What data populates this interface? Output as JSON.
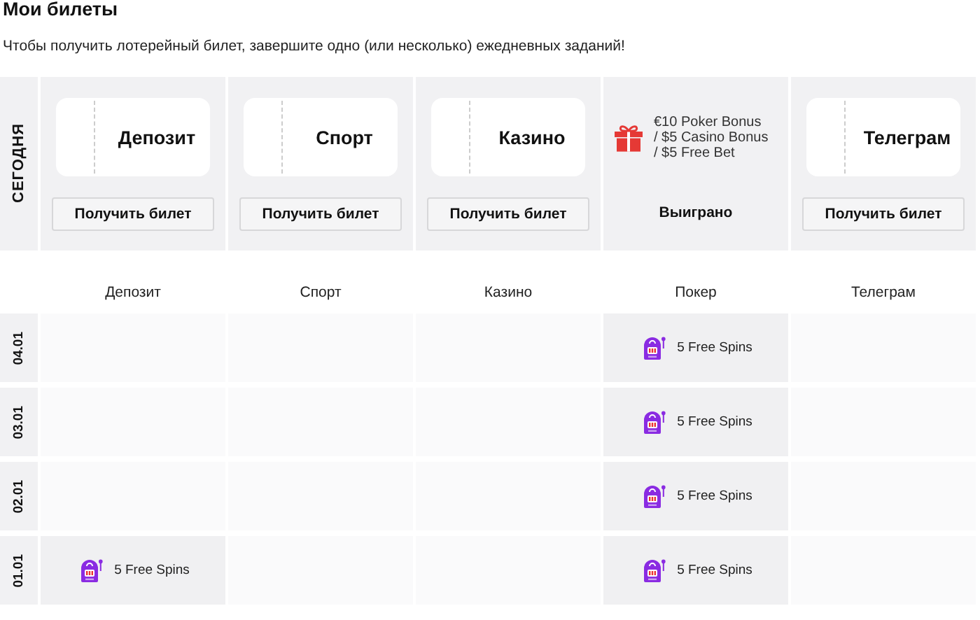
{
  "title": "Мои билеты",
  "subtitle": "Чтобы получить лотерейный билет, завершите одно (или несколько) ежедневных заданий!",
  "today": {
    "label": "СЕГОДНЯ",
    "tasks": [
      {
        "kind": "ticket",
        "label": "Депозит",
        "button": "Получить билет"
      },
      {
        "kind": "ticket",
        "label": "Спорт",
        "button": "Получить билет"
      },
      {
        "kind": "ticket",
        "label": "Казино",
        "button": "Получить билет"
      },
      {
        "kind": "won",
        "prize_lines": [
          "€10 Poker Bonus",
          "/ $5 Casino Bonus",
          "/ $5 Free Bet"
        ],
        "status": "Выиграно"
      },
      {
        "kind": "ticket",
        "label": "Телеграм",
        "button": "Получить билет"
      }
    ]
  },
  "history": {
    "columns": [
      "Депозит",
      "Спорт",
      "Казино",
      "Покер",
      "Телеграм"
    ],
    "rows": [
      {
        "date": "04.01",
        "cells": [
          {
            "won": false
          },
          {
            "won": false
          },
          {
            "won": false
          },
          {
            "won": true,
            "reward": "5 Free Spins"
          },
          {
            "won": false
          }
        ]
      },
      {
        "date": "03.01",
        "cells": [
          {
            "won": false
          },
          {
            "won": false
          },
          {
            "won": false
          },
          {
            "won": true,
            "reward": "5 Free Spins"
          },
          {
            "won": false
          }
        ]
      },
      {
        "date": "02.01",
        "cells": [
          {
            "won": false
          },
          {
            "won": false
          },
          {
            "won": false
          },
          {
            "won": true,
            "reward": "5 Free Spins"
          },
          {
            "won": false
          }
        ]
      },
      {
        "date": "01.01",
        "cells": [
          {
            "won": true,
            "reward": "5 Free Spins"
          },
          {
            "won": false
          },
          {
            "won": false
          },
          {
            "won": true,
            "reward": "5 Free Spins"
          },
          {
            "won": false
          }
        ]
      }
    ]
  }
}
